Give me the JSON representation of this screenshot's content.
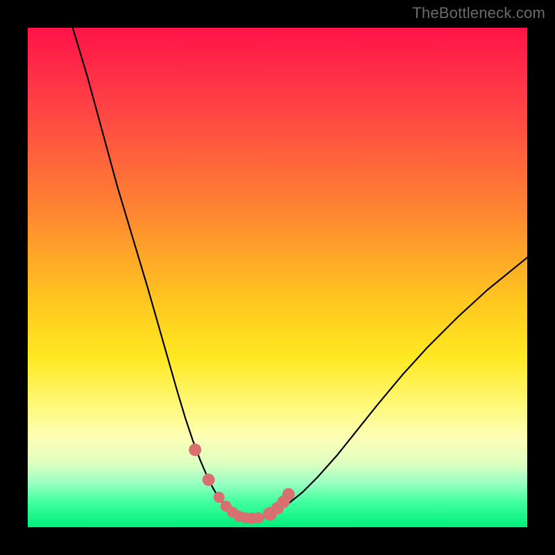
{
  "watermark": "TheBottleneck.com",
  "colors": {
    "frame": "#000000",
    "curve": "#000000",
    "marker": "#d97070"
  },
  "chart_data": {
    "type": "line",
    "title": "",
    "xlabel": "",
    "ylabel": "",
    "xlim": [
      0,
      100
    ],
    "ylim": [
      0,
      100
    ],
    "grid": false,
    "legend": false,
    "series": [
      {
        "name": "bottleneck-curve",
        "x": [
          9,
          12,
          15,
          18,
          21,
          24,
          26,
          28,
          30,
          31.5,
          33,
          34.5,
          36,
          37,
          38,
          39,
          40,
          41,
          42,
          43,
          44,
          45,
          46,
          48,
          50,
          52,
          55,
          58,
          62,
          66,
          70,
          75,
          80,
          86,
          92,
          100
        ],
        "y": [
          100,
          90,
          79,
          68,
          58,
          48,
          41,
          34,
          27,
          22,
          17.5,
          13.5,
          10,
          8,
          6.3,
          5,
          3.8,
          3,
          2.3,
          1.9,
          1.6,
          1.5,
          1.6,
          2.2,
          3.2,
          4.6,
          7,
          10,
          14.5,
          19.5,
          24.5,
          30.5,
          36,
          42,
          47.5,
          54
        ]
      }
    ],
    "markers": {
      "name": "floor-markers",
      "x": [
        33.5,
        36.2,
        38.3,
        39.7,
        41.0,
        42.3,
        43.6,
        44.9,
        46.2,
        48.5,
        50.0,
        51.2,
        52.2
      ],
      "y": [
        15.5,
        9.5,
        6.0,
        4.2,
        3.0,
        2.2,
        1.9,
        1.8,
        1.9,
        2.7,
        3.8,
        5.1,
        6.6
      ],
      "r": [
        9,
        9,
        8,
        8,
        8,
        8,
        8,
        8,
        8,
        10,
        9,
        9,
        9
      ]
    },
    "gradient_stops": [
      {
        "pos": 0.0,
        "color": "#ff1447"
      },
      {
        "pos": 0.08,
        "color": "#ff2a48"
      },
      {
        "pos": 0.22,
        "color": "#ff5640"
      },
      {
        "pos": 0.38,
        "color": "#ff8a30"
      },
      {
        "pos": 0.55,
        "color": "#ffc81f"
      },
      {
        "pos": 0.66,
        "color": "#ffe922"
      },
      {
        "pos": 0.76,
        "color": "#fff97d"
      },
      {
        "pos": 0.82,
        "color": "#fdffb6"
      },
      {
        "pos": 0.87,
        "color": "#e0ffc0"
      },
      {
        "pos": 0.91,
        "color": "#9cffc3"
      },
      {
        "pos": 0.95,
        "color": "#40ff9f"
      },
      {
        "pos": 1.0,
        "color": "#00ee7a"
      }
    ]
  }
}
